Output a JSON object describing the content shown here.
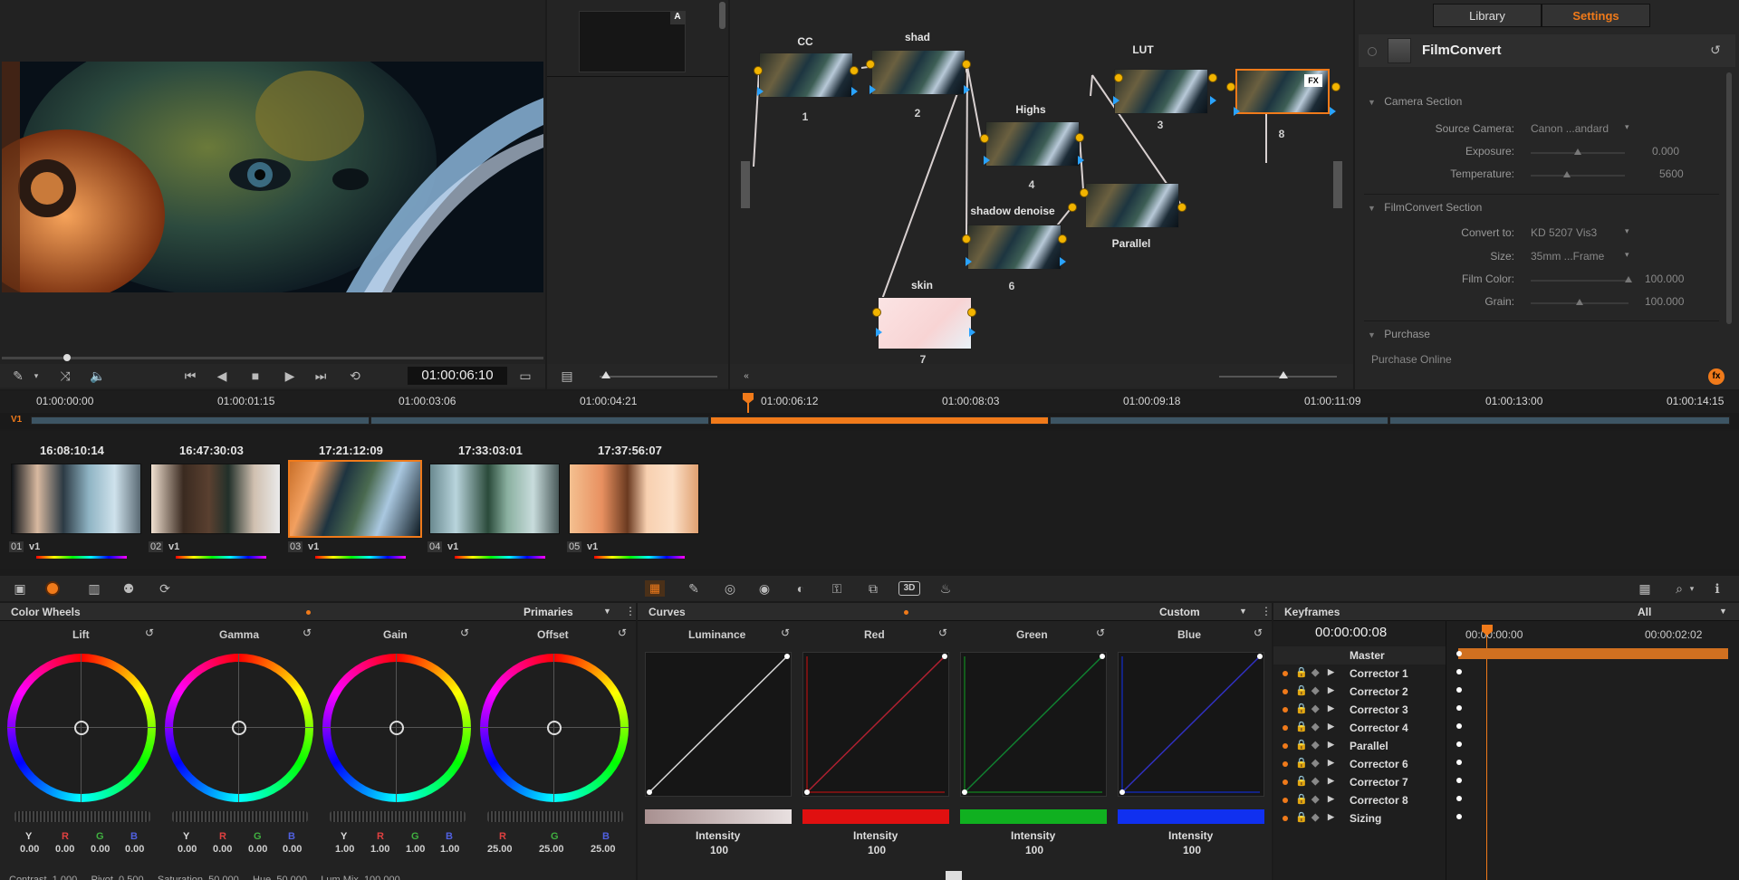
{
  "viewer": {
    "timecode": "01:00:06:10"
  },
  "gallery": {
    "badge": "A"
  },
  "nodes": [
    {
      "label": "CC",
      "num": "1"
    },
    {
      "label": "shad",
      "num": "2"
    },
    {
      "label": "Highs",
      "num": "4"
    },
    {
      "label": "shadow denoise",
      "num": "6"
    },
    {
      "label": "skin",
      "num": "7"
    },
    {
      "label": "LUT",
      "num": "3"
    },
    {
      "label": "",
      "num": "8"
    },
    {
      "label": "Parallel",
      "num": ""
    }
  ],
  "inspector": {
    "tabs": [
      "Library",
      "Settings"
    ],
    "plugin": "FilmConvert",
    "camera_section": "Camera Section",
    "source_camera_label": "Source Camera:",
    "source_camera_value": "Canon ...andard",
    "exposure_label": "Exposure:",
    "exposure_value": "0.000",
    "temperature_label": "Temperature:",
    "temperature_value": "5600",
    "filmconvert_section": "FilmConvert Section",
    "convert_to_label": "Convert to:",
    "convert_to_value": "KD 5207 Vis3",
    "size_label": "Size:",
    "size_value": "35mm ...Frame",
    "film_color_label": "Film Color:",
    "film_color_value": "100.000",
    "grain_label": "Grain:",
    "grain_value": "100.000",
    "purchase_section": "Purchase",
    "purchase_online": "Purchase Online"
  },
  "timeline": {
    "track": "V1",
    "ruler": [
      "01:00:00:00",
      "01:00:01:15",
      "01:00:03:06",
      "01:00:04:21",
      "01:00:06:12",
      "01:00:08:03",
      "01:00:09:18",
      "01:00:11:09",
      "01:00:13:00",
      "01:00:14:15"
    ]
  },
  "clips": [
    {
      "tc": "16:08:10:14",
      "num": "01",
      "ver": "v1"
    },
    {
      "tc": "16:47:30:03",
      "num": "02",
      "ver": "v1"
    },
    {
      "tc": "17:21:12:09",
      "num": "03",
      "ver": "v1"
    },
    {
      "tc": "17:33:03:01",
      "num": "04",
      "ver": "v1"
    },
    {
      "tc": "17:37:56:07",
      "num": "05",
      "ver": "v1"
    }
  ],
  "color_wheels": {
    "title": "Color Wheels",
    "mode": "Primaries",
    "wheels": [
      {
        "name": "Lift",
        "labels": [
          "Y",
          "R",
          "G",
          "B"
        ],
        "values": [
          "0.00",
          "0.00",
          "0.00",
          "0.00"
        ]
      },
      {
        "name": "Gamma",
        "labels": [
          "Y",
          "R",
          "G",
          "B"
        ],
        "values": [
          "0.00",
          "0.00",
          "0.00",
          "0.00"
        ]
      },
      {
        "name": "Gain",
        "labels": [
          "Y",
          "R",
          "G",
          "B"
        ],
        "values": [
          "1.00",
          "1.00",
          "1.00",
          "1.00"
        ]
      },
      {
        "name": "Offset",
        "labels": [
          "R",
          "G",
          "B"
        ],
        "values": [
          "25.00",
          "25.00",
          "25.00"
        ]
      }
    ],
    "footer": "Contrast  1.000     Pivot  0.500     Saturation  50.000     Hue  50.000     Lum Mix  100.000"
  },
  "curves": {
    "title": "Curves",
    "mode": "Custom",
    "channels": [
      {
        "name": "Luminance",
        "intensity_label": "Intensity",
        "intensity": "100",
        "color": "#d8d8d8"
      },
      {
        "name": "Red",
        "intensity_label": "Intensity",
        "intensity": "100",
        "color": "#e01010"
      },
      {
        "name": "Green",
        "intensity_label": "Intensity",
        "intensity": "100",
        "color": "#10b020"
      },
      {
        "name": "Blue",
        "intensity_label": "Intensity",
        "intensity": "100",
        "color": "#1030f0"
      }
    ]
  },
  "keyframes": {
    "title": "Keyframes",
    "filter": "All",
    "timecode": "00:00:00:08",
    "ruler": [
      "00:00:00:00",
      "00:00:02:02"
    ],
    "rows": [
      "Master",
      "Corrector 1",
      "Corrector 2",
      "Corrector 3",
      "Corrector 4",
      "Parallel",
      "Corrector 6",
      "Corrector 7",
      "Corrector 8",
      "Sizing"
    ]
  },
  "colors": {
    "accent": "#f07a1a"
  }
}
